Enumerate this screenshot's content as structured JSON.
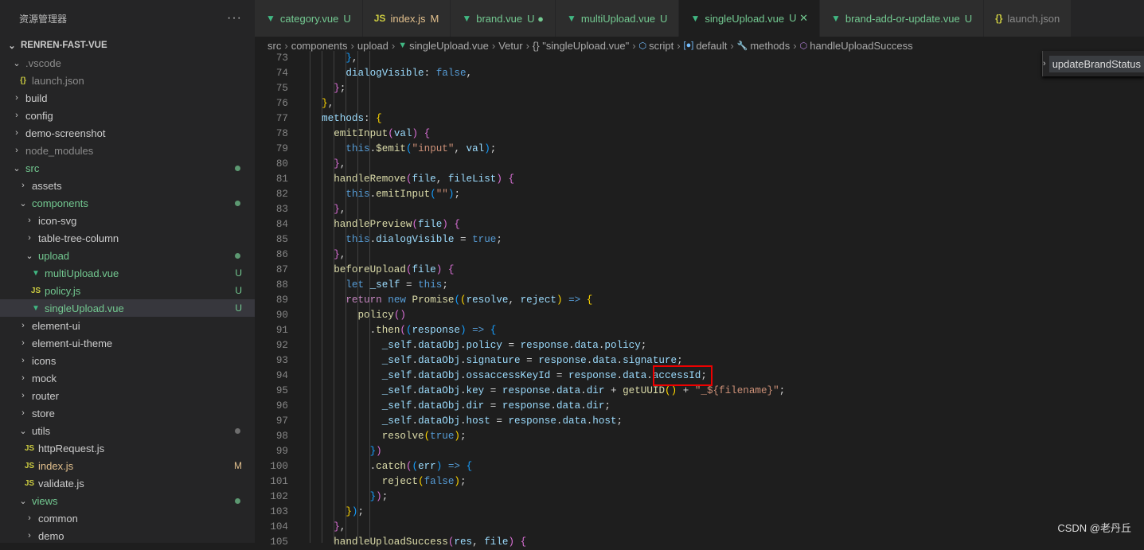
{
  "explorer": {
    "title": "资源管理器",
    "more": "···",
    "root": "RENREN-FAST-VUE",
    "items": [
      {
        "label": ".vscode",
        "depth": 1,
        "type": "folder",
        "open": true,
        "color": "#8b8b8b"
      },
      {
        "label": "launch.json",
        "depth": 2,
        "type": "json",
        "color": "#8b8b8b"
      },
      {
        "label": "build",
        "depth": 1,
        "type": "folder",
        "open": false,
        "color": "#ccc"
      },
      {
        "label": "config",
        "depth": 1,
        "type": "folder",
        "open": false,
        "color": "#ccc"
      },
      {
        "label": "demo-screenshot",
        "depth": 1,
        "type": "folder",
        "open": false,
        "color": "#ccc"
      },
      {
        "label": "node_modules",
        "depth": 1,
        "type": "folder",
        "open": false,
        "color": "#8b8b8b"
      },
      {
        "label": "src",
        "depth": 1,
        "type": "folder",
        "open": true,
        "color": "#73c991",
        "dot": true
      },
      {
        "label": "assets",
        "depth": 2,
        "type": "folder",
        "open": false,
        "color": "#ccc"
      },
      {
        "label": "components",
        "depth": 2,
        "type": "folder",
        "open": true,
        "color": "#73c991",
        "dot": true
      },
      {
        "label": "icon-svg",
        "depth": 3,
        "type": "folder",
        "open": false,
        "color": "#ccc"
      },
      {
        "label": "table-tree-column",
        "depth": 3,
        "type": "folder",
        "open": false,
        "color": "#ccc"
      },
      {
        "label": "upload",
        "depth": 3,
        "type": "folder",
        "open": true,
        "color": "#73c991",
        "dot": true
      },
      {
        "label": "multiUpload.vue",
        "depth": 4,
        "type": "vue",
        "color": "#73c991",
        "badge": "U"
      },
      {
        "label": "policy.js",
        "depth": 4,
        "type": "js",
        "color": "#73c991",
        "badge": "U"
      },
      {
        "label": "singleUpload.vue",
        "depth": 4,
        "type": "vue",
        "color": "#73c991",
        "badge": "U",
        "selected": true
      },
      {
        "label": "element-ui",
        "depth": 2,
        "type": "folder",
        "open": false,
        "color": "#ccc"
      },
      {
        "label": "element-ui-theme",
        "depth": 2,
        "type": "folder",
        "open": false,
        "color": "#ccc"
      },
      {
        "label": "icons",
        "depth": 2,
        "type": "folder",
        "open": false,
        "color": "#ccc"
      },
      {
        "label": "mock",
        "depth": 2,
        "type": "folder",
        "open": false,
        "color": "#ccc"
      },
      {
        "label": "router",
        "depth": 2,
        "type": "folder",
        "open": false,
        "color": "#ccc"
      },
      {
        "label": "store",
        "depth": 2,
        "type": "folder",
        "open": false,
        "color": "#ccc"
      },
      {
        "label": "utils",
        "depth": 2,
        "type": "folder",
        "open": true,
        "color": "#ccc",
        "dot": true,
        "dotColor": "#8b8b8b"
      },
      {
        "label": "httpRequest.js",
        "depth": 3,
        "type": "js",
        "color": "#ccc"
      },
      {
        "label": "index.js",
        "depth": 3,
        "type": "js",
        "color": "#e2c08d",
        "badge": "M"
      },
      {
        "label": "validate.js",
        "depth": 3,
        "type": "js",
        "color": "#ccc"
      },
      {
        "label": "views",
        "depth": 2,
        "type": "folder",
        "open": true,
        "color": "#73c991",
        "dot": true
      },
      {
        "label": "common",
        "depth": 3,
        "type": "folder",
        "open": false,
        "color": "#ccc"
      },
      {
        "label": "demo",
        "depth": 3,
        "type": "folder",
        "open": false,
        "color": "#ccc"
      }
    ]
  },
  "tabs": [
    {
      "label": "category.vue",
      "badge": "U",
      "type": "vue",
      "color": "#73c991"
    },
    {
      "label": "index.js",
      "badge": "M",
      "type": "js",
      "color": "#e2c08d"
    },
    {
      "label": "brand.vue",
      "badge": "U ●",
      "type": "vue",
      "color": "#73c991"
    },
    {
      "label": "multiUpload.vue",
      "badge": "U",
      "type": "vue",
      "color": "#73c991"
    },
    {
      "label": "singleUpload.vue",
      "badge": "U ✕",
      "type": "vue",
      "color": "#73c991",
      "active": true
    },
    {
      "label": "brand-add-or-update.vue",
      "badge": "U",
      "type": "vue",
      "color": "#73c991"
    },
    {
      "label": "launch.json",
      "badge": "",
      "type": "json",
      "color": "#8b8b8b"
    }
  ],
  "breadcrumb": [
    "src",
    "components",
    "upload",
    "singleUpload.vue",
    "Vetur",
    "{} \"singleUpload.vue\"",
    "script",
    "default",
    "methods",
    "handleUploadSuccess"
  ],
  "sticky_outline": "updateBrandStatus",
  "watermark": "CSDN @老丹丘",
  "code": {
    "start": 73,
    "lines": [
      [
        [
          "p",
          "      "
        ],
        [
          "b3",
          "}"
        ],
        [
          "p",
          ","
        ]
      ],
      [
        [
          "p",
          "      "
        ],
        [
          "v",
          "dialogVisible"
        ],
        [
          "p",
          ": "
        ],
        [
          "k",
          "false"
        ],
        [
          "p",
          ","
        ]
      ],
      [
        [
          "p",
          "    "
        ],
        [
          "b2",
          "}"
        ],
        [
          "p",
          ";"
        ]
      ],
      [
        [
          "p",
          "  "
        ],
        [
          "b1",
          "}"
        ],
        [
          "p",
          ","
        ]
      ],
      [
        [
          "p",
          "  "
        ],
        [
          "v",
          "methods"
        ],
        [
          "p",
          ": "
        ],
        [
          "b1",
          "{"
        ]
      ],
      [
        [
          "p",
          "    "
        ],
        [
          "f",
          "emitInput"
        ],
        [
          "b2",
          "("
        ],
        [
          "v",
          "val"
        ],
        [
          "b2",
          ")"
        ],
        [
          "p",
          " "
        ],
        [
          "b2",
          "{"
        ]
      ],
      [
        [
          "p",
          "      "
        ],
        [
          "k",
          "this"
        ],
        [
          "p",
          "."
        ],
        [
          "f",
          "$emit"
        ],
        [
          "b3",
          "("
        ],
        [
          "s",
          "\"input\""
        ],
        [
          "p",
          ", "
        ],
        [
          "v",
          "val"
        ],
        [
          "b3",
          ")"
        ],
        [
          "p",
          ";"
        ]
      ],
      [
        [
          "p",
          "    "
        ],
        [
          "b2",
          "}"
        ],
        [
          "p",
          ","
        ]
      ],
      [
        [
          "p",
          "    "
        ],
        [
          "f",
          "handleRemove"
        ],
        [
          "b2",
          "("
        ],
        [
          "v",
          "file"
        ],
        [
          "p",
          ", "
        ],
        [
          "v",
          "fileList"
        ],
        [
          "b2",
          ")"
        ],
        [
          "p",
          " "
        ],
        [
          "b2",
          "{"
        ]
      ],
      [
        [
          "p",
          "      "
        ],
        [
          "k",
          "this"
        ],
        [
          "p",
          "."
        ],
        [
          "f",
          "emitInput"
        ],
        [
          "b3",
          "("
        ],
        [
          "s",
          "\"\""
        ],
        [
          "b3",
          ")"
        ],
        [
          "p",
          ";"
        ]
      ],
      [
        [
          "p",
          "    "
        ],
        [
          "b2",
          "}"
        ],
        [
          "p",
          ","
        ]
      ],
      [
        [
          "p",
          "    "
        ],
        [
          "f",
          "handlePreview"
        ],
        [
          "b2",
          "("
        ],
        [
          "v",
          "file"
        ],
        [
          "b2",
          ")"
        ],
        [
          "p",
          " "
        ],
        [
          "b2",
          "{"
        ]
      ],
      [
        [
          "p",
          "      "
        ],
        [
          "k",
          "this"
        ],
        [
          "p",
          "."
        ],
        [
          "v",
          "dialogVisible"
        ],
        [
          "p",
          " = "
        ],
        [
          "k",
          "true"
        ],
        [
          "p",
          ";"
        ]
      ],
      [
        [
          "p",
          "    "
        ],
        [
          "b2",
          "}"
        ],
        [
          "p",
          ","
        ]
      ],
      [
        [
          "p",
          "    "
        ],
        [
          "f",
          "beforeUpload"
        ],
        [
          "b2",
          "("
        ],
        [
          "v",
          "file"
        ],
        [
          "b2",
          ")"
        ],
        [
          "p",
          " "
        ],
        [
          "b2",
          "{"
        ]
      ],
      [
        [
          "p",
          "      "
        ],
        [
          "k",
          "let"
        ],
        [
          "p",
          " "
        ],
        [
          "v",
          "_self"
        ],
        [
          "p",
          " = "
        ],
        [
          "k",
          "this"
        ],
        [
          "p",
          ";"
        ]
      ],
      [
        [
          "p",
          "      "
        ],
        [
          "c",
          "return"
        ],
        [
          "p",
          " "
        ],
        [
          "k",
          "new"
        ],
        [
          "p",
          " "
        ],
        [
          "f",
          "Promise"
        ],
        [
          "b3",
          "("
        ],
        [
          "b1",
          "("
        ],
        [
          "v",
          "resolve"
        ],
        [
          "p",
          ", "
        ],
        [
          "v",
          "reject"
        ],
        [
          "b1",
          ")"
        ],
        [
          "p",
          " "
        ],
        [
          "k",
          "=>"
        ],
        [
          "p",
          " "
        ],
        [
          "b1",
          "{"
        ]
      ],
      [
        [
          "p",
          "        "
        ],
        [
          "f",
          "policy"
        ],
        [
          "b2",
          "("
        ],
        [
          "b2",
          ")"
        ]
      ],
      [
        [
          "p",
          "          ."
        ],
        [
          "f",
          "then"
        ],
        [
          "b2",
          "("
        ],
        [
          "b3",
          "("
        ],
        [
          "v",
          "response"
        ],
        [
          "b3",
          ")"
        ],
        [
          "p",
          " "
        ],
        [
          "k",
          "=>"
        ],
        [
          "p",
          " "
        ],
        [
          "b3",
          "{"
        ]
      ],
      [
        [
          "p",
          "            "
        ],
        [
          "v",
          "_self"
        ],
        [
          "p",
          "."
        ],
        [
          "v",
          "dataObj"
        ],
        [
          "p",
          "."
        ],
        [
          "v",
          "policy"
        ],
        [
          "p",
          " = "
        ],
        [
          "v",
          "response"
        ],
        [
          "p",
          "."
        ],
        [
          "v",
          "data"
        ],
        [
          "p",
          "."
        ],
        [
          "v",
          "policy"
        ],
        [
          "p",
          ";"
        ]
      ],
      [
        [
          "p",
          "            "
        ],
        [
          "v",
          "_self"
        ],
        [
          "p",
          "."
        ],
        [
          "v",
          "dataObj"
        ],
        [
          "p",
          "."
        ],
        [
          "v",
          "signature"
        ],
        [
          "p",
          " = "
        ],
        [
          "v",
          "response"
        ],
        [
          "p",
          "."
        ],
        [
          "v",
          "data"
        ],
        [
          "p",
          "."
        ],
        [
          "v",
          "signature"
        ],
        [
          "p",
          ";"
        ]
      ],
      [
        [
          "p",
          "            "
        ],
        [
          "v",
          "_self"
        ],
        [
          "p",
          "."
        ],
        [
          "v",
          "dataObj"
        ],
        [
          "p",
          "."
        ],
        [
          "v",
          "ossaccessKeyId"
        ],
        [
          "p",
          " = "
        ],
        [
          "v",
          "response"
        ],
        [
          "p",
          "."
        ],
        [
          "v",
          "data"
        ],
        [
          "p",
          "."
        ],
        [
          "v",
          "accessId"
        ],
        [
          "p",
          ";"
        ]
      ],
      [
        [
          "p",
          "            "
        ],
        [
          "v",
          "_self"
        ],
        [
          "p",
          "."
        ],
        [
          "v",
          "dataObj"
        ],
        [
          "p",
          "."
        ],
        [
          "v",
          "key"
        ],
        [
          "p",
          " = "
        ],
        [
          "v",
          "response"
        ],
        [
          "p",
          "."
        ],
        [
          "v",
          "data"
        ],
        [
          "p",
          "."
        ],
        [
          "v",
          "dir"
        ],
        [
          "p",
          " + "
        ],
        [
          "f",
          "getUUID"
        ],
        [
          "b1",
          "("
        ],
        [
          "b1",
          ")"
        ],
        [
          "p",
          " + "
        ],
        [
          "s",
          "\"_${filename}\""
        ],
        [
          "p",
          ";"
        ]
      ],
      [
        [
          "p",
          "            "
        ],
        [
          "v",
          "_self"
        ],
        [
          "p",
          "."
        ],
        [
          "v",
          "dataObj"
        ],
        [
          "p",
          "."
        ],
        [
          "v",
          "dir"
        ],
        [
          "p",
          " = "
        ],
        [
          "v",
          "response"
        ],
        [
          "p",
          "."
        ],
        [
          "v",
          "data"
        ],
        [
          "p",
          "."
        ],
        [
          "v",
          "dir"
        ],
        [
          "p",
          ";"
        ]
      ],
      [
        [
          "p",
          "            "
        ],
        [
          "v",
          "_self"
        ],
        [
          "p",
          "."
        ],
        [
          "v",
          "dataObj"
        ],
        [
          "p",
          "."
        ],
        [
          "v",
          "host"
        ],
        [
          "p",
          " = "
        ],
        [
          "v",
          "response"
        ],
        [
          "p",
          "."
        ],
        [
          "v",
          "data"
        ],
        [
          "p",
          "."
        ],
        [
          "v",
          "host"
        ],
        [
          "p",
          ";"
        ]
      ],
      [
        [
          "p",
          "            "
        ],
        [
          "f",
          "resolve"
        ],
        [
          "b1",
          "("
        ],
        [
          "k",
          "true"
        ],
        [
          "b1",
          ")"
        ],
        [
          "p",
          ";"
        ]
      ],
      [
        [
          "p",
          "          "
        ],
        [
          "b3",
          "}"
        ],
        [
          "b2",
          ")"
        ]
      ],
      [
        [
          "p",
          "          ."
        ],
        [
          "f",
          "catch"
        ],
        [
          "b2",
          "("
        ],
        [
          "b3",
          "("
        ],
        [
          "v",
          "err"
        ],
        [
          "b3",
          ")"
        ],
        [
          "p",
          " "
        ],
        [
          "k",
          "=>"
        ],
        [
          "p",
          " "
        ],
        [
          "b3",
          "{"
        ]
      ],
      [
        [
          "p",
          "            "
        ],
        [
          "f",
          "reject"
        ],
        [
          "b1",
          "("
        ],
        [
          "k",
          "false"
        ],
        [
          "b1",
          ")"
        ],
        [
          "p",
          ";"
        ]
      ],
      [
        [
          "p",
          "          "
        ],
        [
          "b3",
          "}"
        ],
        [
          "b2",
          ")"
        ],
        [
          "p",
          ";"
        ]
      ],
      [
        [
          "p",
          "      "
        ],
        [
          "b1",
          "}"
        ],
        [
          "b3",
          ")"
        ],
        [
          "p",
          ";"
        ]
      ],
      [
        [
          "p",
          "    "
        ],
        [
          "b2",
          "}"
        ],
        [
          "p",
          ","
        ]
      ],
      [
        [
          "p",
          "    "
        ],
        [
          "f",
          "handleUploadSuccess"
        ],
        [
          "b2",
          "("
        ],
        [
          "v",
          "res"
        ],
        [
          "p",
          ", "
        ],
        [
          "v",
          "file"
        ],
        [
          "b2",
          ")"
        ],
        [
          "p",
          " "
        ],
        [
          "b2",
          "{"
        ]
      ]
    ]
  }
}
